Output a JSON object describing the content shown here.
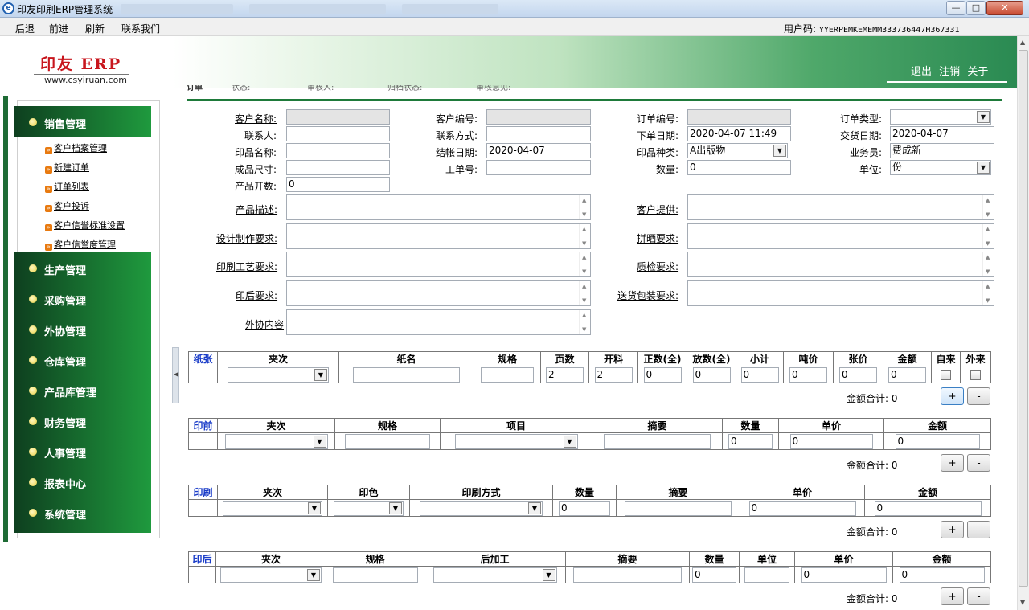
{
  "window": {
    "title": "印友印刷ERP管理系统",
    "min": "—",
    "max": "□",
    "close": "✕"
  },
  "menu": {
    "back": "后退",
    "forward": "前进",
    "refresh": "刷新",
    "contact": "联系我们",
    "user_code_label": "用户码:",
    "user_code": "YYERPEMKEMEMM333736447H367331"
  },
  "logo": {
    "brand": "印友 ERP",
    "url": "www.csyiruan.com"
  },
  "header_links": {
    "logout": "退出",
    "cancel": "注销",
    "about": "关于"
  },
  "strip": {
    "order": "订单",
    "status": "状态:",
    "reviewer": "审核人:",
    "archive": "归档状态:",
    "opinion": "审核意见:"
  },
  "sidebar": {
    "sales": "销售管理",
    "sales_items": [
      "客户档案管理",
      "新建订单",
      "订单列表",
      "客户投诉",
      "客户信誉标准设置",
      "客户信誉度管理"
    ],
    "sections": [
      "生产管理",
      "采购管理",
      "外协管理",
      "仓库管理",
      "产品库管理",
      "财务管理",
      "人事管理",
      "报表中心",
      "系统管理"
    ]
  },
  "form": {
    "customer_name": {
      "label": "客户名称:",
      "value": ""
    },
    "customer_no": {
      "label": "客户编号:",
      "value": ""
    },
    "order_no": {
      "label": "订单编号:",
      "value": ""
    },
    "order_type": {
      "label": "订单类型:",
      "value": ""
    },
    "contact": {
      "label": "联系人:",
      "value": ""
    },
    "contact_way": {
      "label": "联系方式:",
      "value": ""
    },
    "order_date": {
      "label": "下单日期:",
      "value": "2020-04-07 11:49"
    },
    "delivery_date": {
      "label": "交货日期:",
      "value": "2020-04-07"
    },
    "print_name": {
      "label": "印品名称:",
      "value": ""
    },
    "settle_date": {
      "label": "结帐日期:",
      "value": "2020-04-07"
    },
    "print_type": {
      "label": "印品种类:",
      "value": "A出版物"
    },
    "salesman": {
      "label": "业务员:",
      "value": "费成新"
    },
    "finished_size": {
      "label": "成品尺寸:",
      "value": ""
    },
    "job_no": {
      "label": "工单号:",
      "value": ""
    },
    "quantity": {
      "label": "数量:",
      "value": "0"
    },
    "unit": {
      "label": "单位:",
      "value": "份"
    },
    "open_count": {
      "label": "产品开数:",
      "value": "0"
    },
    "product_desc": "产品描述:",
    "customer_supply": "客户提供:",
    "design_req": "设计制作要求:",
    "imposition_req": "拼晒要求:",
    "print_req": "印刷工艺要求:",
    "qc_req": "质检要求:",
    "post_req": "印后要求:",
    "delivery_req": "送货包装要求:",
    "outsource": "外协内容"
  },
  "paper": {
    "tag": "纸张",
    "headers": [
      "夹次",
      "纸名",
      "规格",
      "页数",
      "开料",
      "正数(全)",
      "放数(全)",
      "小计",
      "吨价",
      "张价",
      "金额",
      "自来",
      "外来"
    ],
    "row": {
      "pages": "2",
      "cut": "2",
      "count": "0",
      "extra": "0",
      "subtotal": "0",
      "ton_price": "0",
      "sheet_price": "0",
      "amount": "0"
    },
    "total_label": "金额合计:",
    "total": "0"
  },
  "prepress": {
    "tag": "印前",
    "headers": [
      "夹次",
      "规格",
      "项目",
      "摘要",
      "数量",
      "单价",
      "金额"
    ],
    "row": {
      "qty": "0",
      "price": "0",
      "amount": "0"
    },
    "total_label": "金额合计:",
    "total": "0"
  },
  "printing": {
    "tag": "印刷",
    "headers": [
      "夹次",
      "印色",
      "印刷方式",
      "数量",
      "摘要",
      "单价",
      "金额"
    ],
    "row": {
      "qty": "0",
      "price": "0",
      "amount": "0"
    },
    "total_label": "金额合计:",
    "total": "0"
  },
  "postpress": {
    "tag": "印后",
    "headers": [
      "夹次",
      "规格",
      "后加工",
      "摘要",
      "数量",
      "单位",
      "单价",
      "金额"
    ],
    "row": {
      "qty": "0",
      "price": "0",
      "amount": "0"
    },
    "total_label": "金额合计:",
    "total": "0"
  },
  "buttons": {
    "plus": "+",
    "minus": "-"
  }
}
